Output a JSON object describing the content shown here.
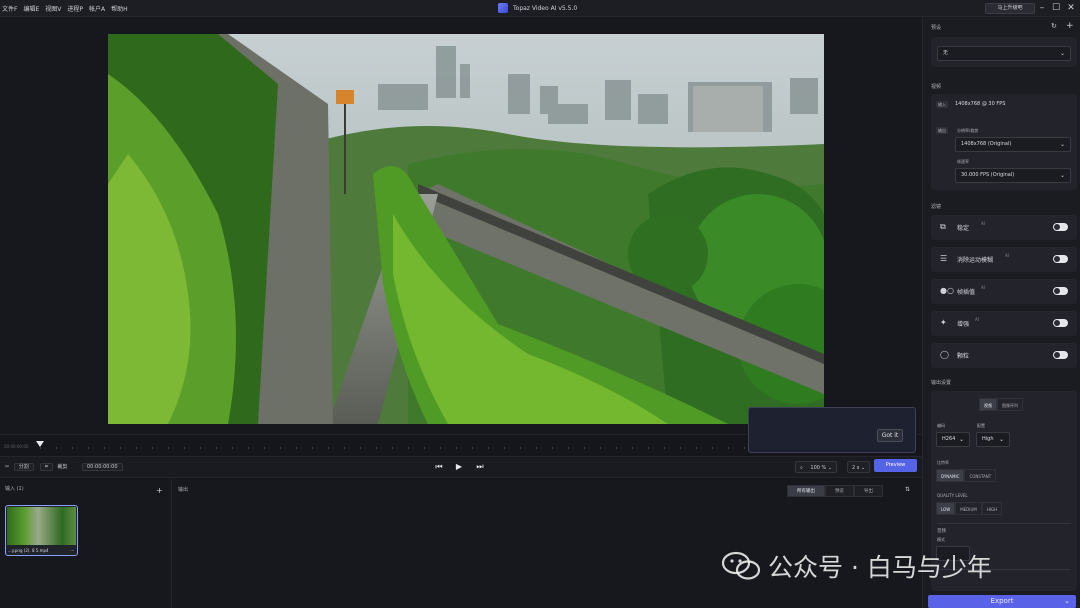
{
  "menu": [
    "文件F",
    "编辑E",
    "视图V",
    "进程P",
    "帐户A",
    "帮助H"
  ],
  "app_title": "Topaz Video AI  v5.5.0",
  "upgrade_label": "马上升级吧",
  "window_controls": [
    "minimize-icon",
    "maximize-icon",
    "close-icon"
  ],
  "timeline": {
    "start_time": "00:00:00:00"
  },
  "controls": {
    "split_label": "分割",
    "crop_label": "裁剪",
    "timecode": "00:00:00:00",
    "zoom_value": "100 %",
    "speed_value": "2 s",
    "preview_label": "Preview"
  },
  "popover": {
    "got_it": "Got it"
  },
  "inputs": {
    "title": "输入 (1)",
    "add": "+",
    "file_caption": "...y.png (2). 8 5.mp4",
    "more": "···"
  },
  "output": {
    "title": "输出",
    "tabs": [
      "所有输出",
      "预览",
      "导出"
    ],
    "active_tab": 0
  },
  "right": {
    "presets_title": "预设",
    "preset_value": "无",
    "video_title": "视频",
    "input_tag": "输入",
    "input_info": "1408x768 @ 30 FPS",
    "output_tag": "输出",
    "resolution_label": "分辨率/裁剪",
    "resolution_value": "1408x768 (Original)",
    "framerate_label": "帧速率",
    "framerate_value": "30.000 FPS (Original)",
    "filters_title": "滤镜",
    "filters": [
      {
        "label": "稳定",
        "ai": "AI",
        "icon": "stabilize-icon",
        "on": true
      },
      {
        "label": "消除运动模糊",
        "ai": "AI",
        "icon": "motion-deblur-icon",
        "on": true
      },
      {
        "label": "帧插值",
        "ai": "AI",
        "icon": "frame-interpolation-icon",
        "on": true
      },
      {
        "label": "增强",
        "ai": "AI",
        "icon": "enhance-icon",
        "on": true
      },
      {
        "label": "颗粒",
        "ai": "",
        "icon": "grain-icon",
        "on": true
      }
    ],
    "output_settings_title": "输出设置",
    "out_tabs": [
      "视频",
      "图像序列"
    ],
    "encoder_label": "编码",
    "encoder_value": "H264",
    "profile_label": "配置",
    "profile_value": "High",
    "bitrate_label": "比特率",
    "bitrate_options": [
      "DYNAMIC",
      "CONSTANT"
    ],
    "quality_label": "QUALITY LEVEL",
    "quality_options": [
      "LOW",
      "MEDIUM",
      "HIGH"
    ],
    "audio_title": "音频",
    "audio_mode_label": "模式",
    "export_label": "Export"
  },
  "watermark": "公众号 · 白马与少年",
  "colors": {
    "accent": "#5564e6",
    "background": "#16171c",
    "panel": "#1b1c22"
  }
}
